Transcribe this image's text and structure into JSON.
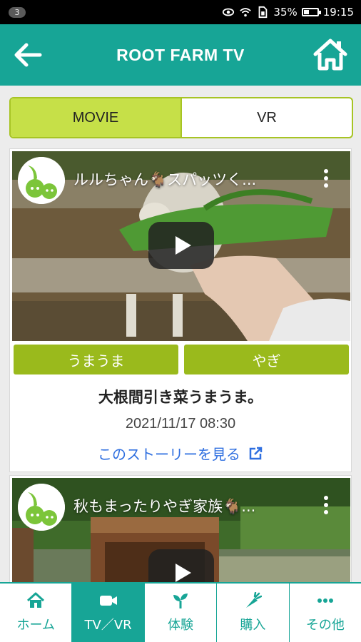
{
  "status_bar": {
    "notification_count": "3",
    "battery": "35%",
    "battery_level": 0.35,
    "time": "19:15"
  },
  "header": {
    "title": "ROOT FARM TV",
    "background_color": "#17a596"
  },
  "tabs": [
    {
      "label": "MOVIE",
      "active": true
    },
    {
      "label": "VR",
      "active": false
    }
  ],
  "videos": [
    {
      "video_title": "ルルちゃん🐐スパッツく...",
      "tags": [
        "うまうま",
        "やぎ"
      ],
      "post_title": "大根間引き菜うまうま。",
      "date": "2021/11/17 08:30",
      "story_link": "このストーリーを見る"
    },
    {
      "video_title": "秋もまったりやぎ家族🐐..."
    }
  ],
  "bottom_nav": [
    {
      "label": "ホーム",
      "icon": "home-icon",
      "active": false
    },
    {
      "label": "TV／VR",
      "icon": "video-camera-icon",
      "active": true
    },
    {
      "label": "体験",
      "icon": "sprout-icon",
      "active": false
    },
    {
      "label": "購入",
      "icon": "carrot-icon",
      "active": false
    },
    {
      "label": "その他",
      "icon": "more-dots-icon",
      "active": false
    }
  ],
  "colors": {
    "accent_teal": "#17a596",
    "tab_active": "#c6e048",
    "tag_green": "#9aba1c",
    "link_blue": "#2f6fe0"
  }
}
